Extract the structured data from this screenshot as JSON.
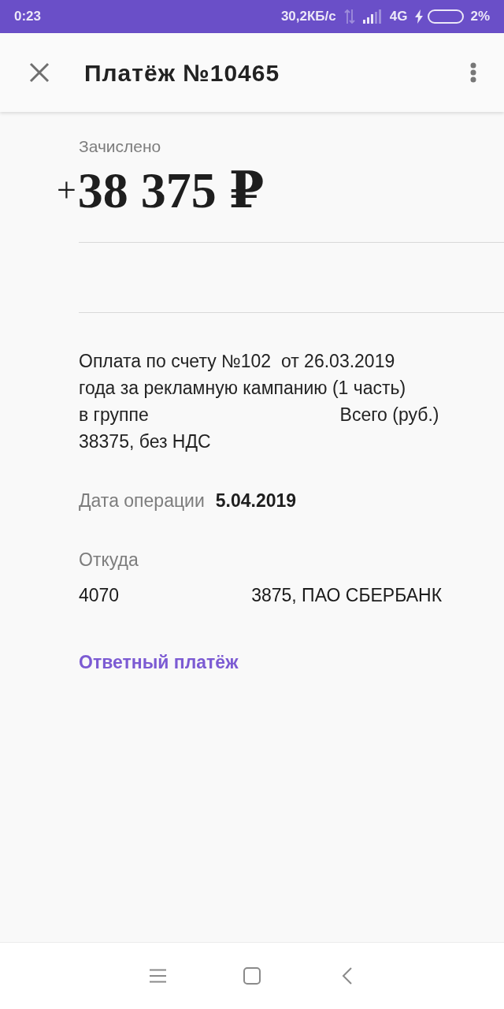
{
  "status_bar": {
    "time": "0:23",
    "speed": "30,2КБ/с",
    "network": "4G",
    "battery": "2%"
  },
  "app_bar": {
    "title": "Платёж №10465"
  },
  "summary": {
    "label": "Зачислено",
    "sign": "+",
    "amount": "38 375 ₽"
  },
  "purpose": "Оплата по счету №102  от 26.03.2019\nгода за рекламную кампанию (1 часть)\nв группе                                      Всего (руб.)\n38375, без НДС",
  "fields": [
    {
      "kind": "inline",
      "label": "Дата операции",
      "value": "5.04.2019"
    },
    {
      "kind": "stacked",
      "label": "Откуда",
      "value_parts": [
        "4070",
        "3875, ПАО СБЕРБАНК"
      ]
    }
  ],
  "action": {
    "label": "Ответный платёж"
  }
}
